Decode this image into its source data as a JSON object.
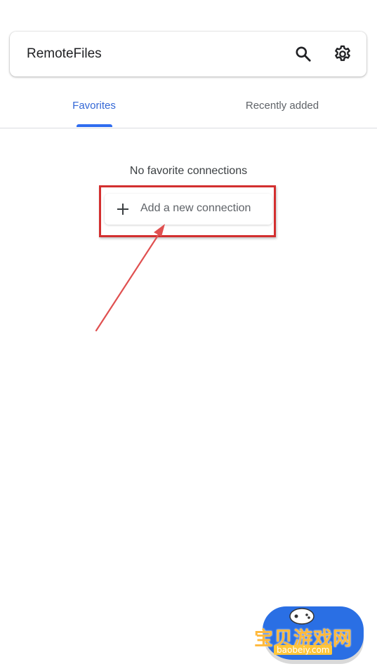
{
  "app_bar": {
    "title": "RemoteFiles",
    "search_icon": "search-icon",
    "settings_icon": "gear-icon"
  },
  "tabs": [
    {
      "label": "Favorites",
      "selected": true
    },
    {
      "label": "Recently added",
      "selected": false
    }
  ],
  "empty_state": {
    "message": "No favorite connections",
    "add_button_label": "Add a new connection",
    "add_icon": "plus-icon"
  },
  "annotation": {
    "box_color": "#d32f2f",
    "arrow_color": "#e05050"
  },
  "watermark": {
    "text": "宝贝游戏网",
    "url": "baobeiy.com"
  },
  "colors": {
    "accent": "#3367d6",
    "tab_indicator": "#2f6cf0",
    "inactive_text": "#5f6368"
  }
}
